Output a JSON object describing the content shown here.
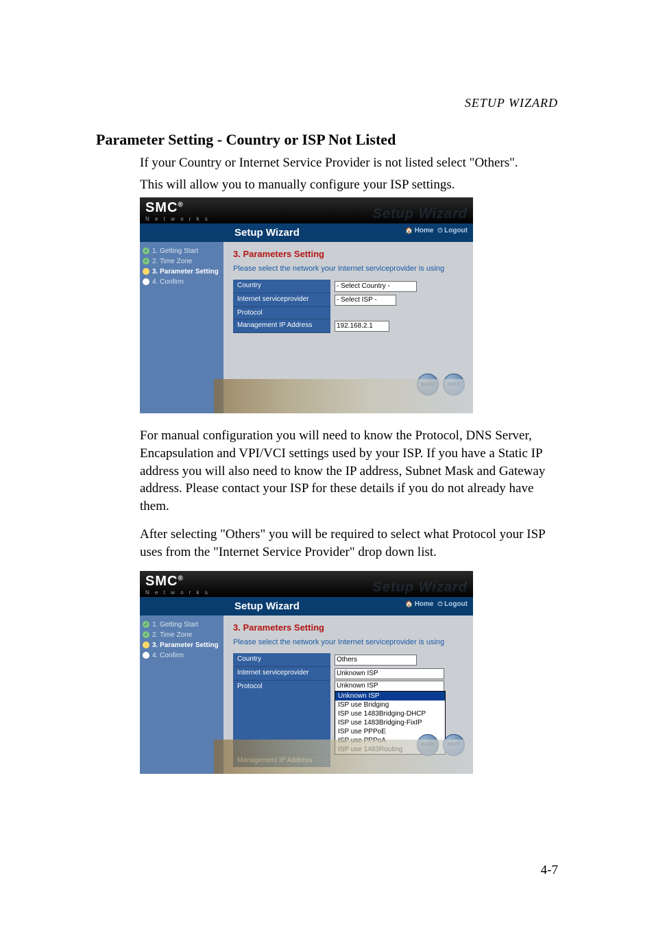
{
  "running_head": "SETUP WIZARD",
  "section_title": "Parameter Setting - Country or ISP Not Listed",
  "intro_line1": "If your Country or Internet Service Provider is not listed select \"Others\".",
  "intro_line2": "This will allow you to manually configure your ISP settings.",
  "para1": "For manual configuration you will need to know the Protocol, DNS Server, Encapsulation and VPI/VCI settings used by your ISP. If you have a Static IP address you will also need to know the IP address, Subnet Mask and Gateway address. Please contact your ISP for these details if you do not already have them.",
  "para2_a": "After selecting \"Others\" you will be required to select what Protocol your ISP uses from the \"Internet Service Provider\" drop down list.",
  "page_num": "4-7",
  "wiz": {
    "logo": "SMC",
    "logo_sub": "N e t w o r k s",
    "ghost": "Setup Wizard",
    "bar_title": "Setup Wizard",
    "link_home": "Home",
    "link_logout": "Logout",
    "steps": [
      {
        "label": "1. Getting Start",
        "state": "done"
      },
      {
        "label": "2. Time Zone",
        "state": "done"
      },
      {
        "label": "3. Parameter Setting",
        "state": "cur"
      },
      {
        "label": "4. Confirm",
        "state": "open"
      }
    ],
    "heading": "3. Parameters Setting",
    "subtext": "Please select the network your Internet serviceprovider is using",
    "labels": {
      "country": "Country",
      "isp": "Internet serviceprovider",
      "protocol": "Protocol",
      "mgmt_ip": "Management IP Address"
    },
    "back": "BACK",
    "next": "NEXT"
  },
  "fig1": {
    "country_value": "- Select Country -",
    "isp_value": "- Select ISP -",
    "protocol_value": "",
    "mgmt_ip_value": "192.168.2.1"
  },
  "fig2": {
    "country_value": "Others",
    "isp_value": "Unknown ISP",
    "protocol_value": "Unknown ISP",
    "mgmt_ip_label": "Management IP Address",
    "options": [
      "Unknown ISP",
      "ISP use Bridging",
      "ISP use 1483Bridging-DHCP",
      "ISP use 1483Bridging-FixIP",
      "ISP use PPPoE",
      "ISP use PPPoA",
      "ISP use 1483Routing"
    ],
    "selected_index": 0
  }
}
